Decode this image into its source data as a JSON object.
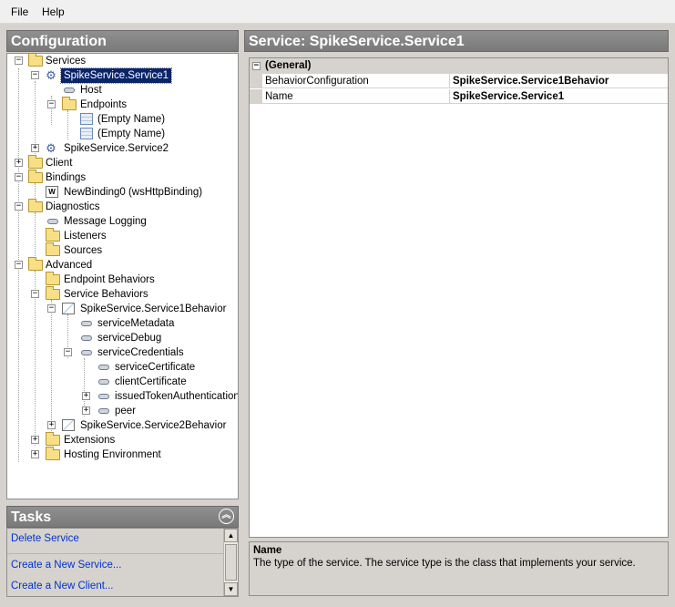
{
  "menu": {
    "file": "File",
    "help": "Help"
  },
  "configuration_panel": {
    "title": "Configuration"
  },
  "service_panel": {
    "title": "Service: SpikeService.Service1"
  },
  "tree": {
    "services": "Services",
    "service1": "SpikeService.Service1",
    "host": "Host",
    "endpoints": "Endpoints",
    "endpoint1": "(Empty Name)",
    "endpoint2": "(Empty Name)",
    "service2": "SpikeService.Service2",
    "client": "Client",
    "bindings": "Bindings",
    "binding1": "NewBinding0 (wsHttpBinding)",
    "diagnostics": "Diagnostics",
    "message_logging": "Message Logging",
    "listeners": "Listeners",
    "sources": "Sources",
    "advanced": "Advanced",
    "endpoint_behaviors": "Endpoint Behaviors",
    "service_behaviors": "Service Behaviors",
    "service1_behavior": "SpikeService.Service1Behavior",
    "service_metadata": "serviceMetadata",
    "service_debug": "serviceDebug",
    "service_credentials": "serviceCredentials",
    "service_certificate": "serviceCertificate",
    "client_certificate": "clientCertificate",
    "issued_token_auth": "issuedTokenAuthentication",
    "peer": "peer",
    "service2_behavior": "SpikeService.Service2Behavior",
    "extensions": "Extensions",
    "hosting_environment": "Hosting Environment"
  },
  "tasks": {
    "title": "Tasks",
    "delete_service": "Delete Service",
    "create_service": "Create a New Service...",
    "create_client": "Create a New Client..."
  },
  "properties": {
    "category": "(General)",
    "rows": [
      {
        "name": "BehaviorConfiguration",
        "value": "SpikeService.Service1Behavior"
      },
      {
        "name": "Name",
        "value": "SpikeService.Service1"
      }
    ]
  },
  "description": {
    "title": "Name",
    "text": "The type of the service. The service type is the class that implements your service."
  },
  "icons": {
    "expander_plus": "+",
    "expander_minus": "−",
    "collapse": "︽",
    "scroll_up": "▲",
    "scroll_down": "▼",
    "service": "⚙",
    "binding": "W"
  }
}
